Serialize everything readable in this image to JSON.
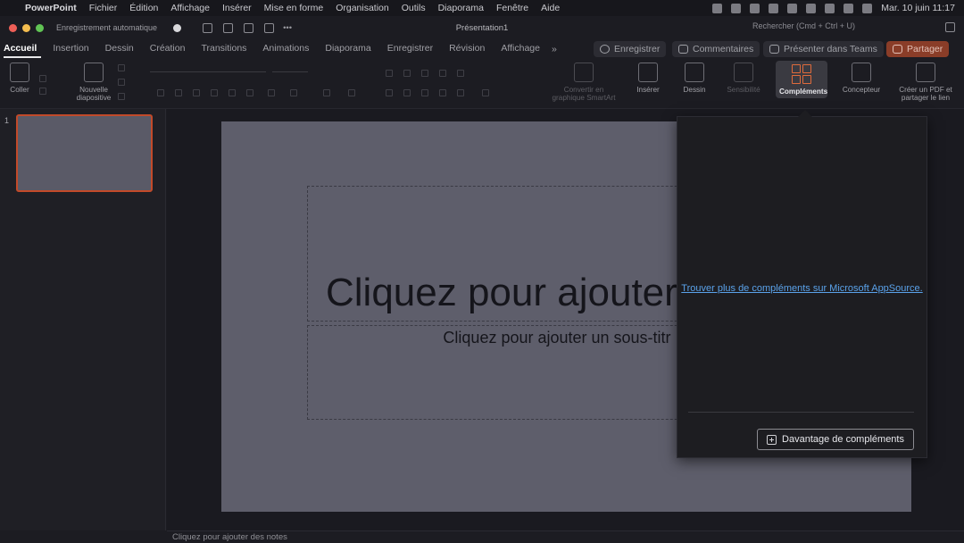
{
  "menubar": {
    "app": "PowerPoint",
    "items": [
      "Fichier",
      "Édition",
      "Affichage",
      "Insérer",
      "Mise en forme",
      "Organisation",
      "Outils",
      "Diaporama",
      "Fenêtre",
      "Aide"
    ],
    "clock": "Mar. 10 juin  11:17"
  },
  "titlebar": {
    "autosave": "Enregistrement automatique",
    "doc_title": "Présentation1",
    "search_placeholder": "Rechercher (Cmd + Ctrl + U)"
  },
  "tabs": [
    "Accueil",
    "Insertion",
    "Dessin",
    "Création",
    "Transitions",
    "Animations",
    "Diaporama",
    "Enregistrer",
    "Révision",
    "Affichage"
  ],
  "tab_more": "»",
  "ribbon_buttons": {
    "record": "Enregistrer",
    "comments": "Commentaires",
    "teams": "Présenter dans Teams",
    "share": "Partager"
  },
  "ribbon": {
    "paste": "Coller",
    "new_slide": "Nouvelle diapositive",
    "smartart": "Convertir en graphique SmartArt",
    "insert": "Insérer",
    "draw": "Dessin",
    "sensitivity": "Sensibilité",
    "addins": "Compléments",
    "designer": "Concepteur",
    "pdf": "Créer un PDF et partager le lien"
  },
  "thumbnails": {
    "number": "1"
  },
  "slide": {
    "title_placeholder": "Cliquez pour ajouter",
    "subtitle_placeholder": "Cliquez pour ajouter un sous-titr"
  },
  "addins_panel": {
    "link": "Trouver plus de compléments sur Microsoft AppSource.",
    "more_button": "Davantage de compléments"
  },
  "notes": {
    "placeholder": "Cliquez pour ajouter des notes"
  },
  "colors": {
    "accent": "#e06b3c",
    "share_bg": "#8a3d28",
    "link": "#5aa2ea"
  }
}
